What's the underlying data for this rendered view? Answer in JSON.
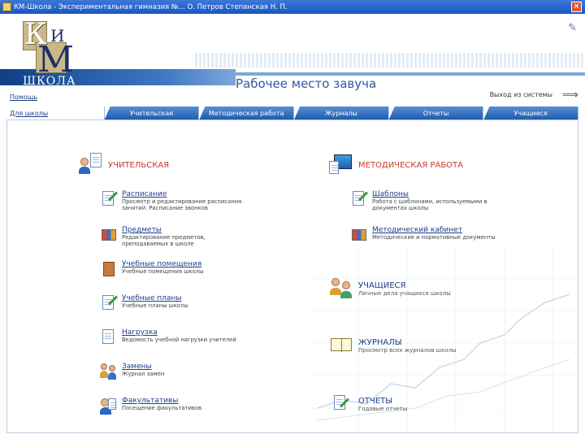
{
  "window": {
    "title": "КМ-Школа - Экспериментальная гимназия №... О. Петров Степанская Н. П."
  },
  "header": {
    "logo_text_k": "К",
    "logo_text_i": "И",
    "logo_text_m": "М",
    "logo_text_school": "ШКОЛА",
    "page_title": "Рабочее место завуча",
    "help_link": "Помощь",
    "exit_link": "Выход из системы"
  },
  "tabs": [
    {
      "label": "Для школы"
    },
    {
      "label": "Учительская"
    },
    {
      "label": "Методическая работа"
    },
    {
      "label": "Журналы"
    },
    {
      "label": "Отчеты"
    },
    {
      "label": "Учащиеся"
    }
  ],
  "left_section": {
    "title": "УЧИТЕЛЬСКАЯ",
    "items": [
      {
        "label": "Расписание",
        "desc": "Просмотр и редактирование расписания занятий. Расписание звонков"
      },
      {
        "label": "Предметы",
        "desc": "Редактирование предметов, преподаваемых в школе"
      },
      {
        "label": "Учебные помещения",
        "desc": "Учебные помещения школы"
      },
      {
        "label": "Учебные планы",
        "desc": "Учебные планы школы"
      },
      {
        "label": "Нагрузка",
        "desc": "Ведомость учебной нагрузки учителей"
      },
      {
        "label": "Замены",
        "desc": "Журнал замен"
      },
      {
        "label": "Факультативы",
        "desc": "Посещение факультативов"
      }
    ]
  },
  "right_section": {
    "title": "МЕТОДИЧЕСКАЯ РАБОТА",
    "items": [
      {
        "label": "Шаблоны",
        "desc": "Работа с шаблонами, используемыми в документах школы"
      },
      {
        "label": "Методический кабинет",
        "desc": "Методические и нормативные документы"
      }
    ]
  },
  "students_section": {
    "title": "УЧАЩИЕСЯ",
    "desc": "Личные дела учащихся школы"
  },
  "journals_section": {
    "title": "ЖУРНАЛЫ",
    "desc": "Просмотр всех журналов школы"
  },
  "reports_section": {
    "title": "ОТЧЕТЫ",
    "desc": "Годовые отчеты"
  },
  "colors": {
    "accent_blue": "#1f5bb2",
    "section_red": "#c8392b",
    "link_blue": "#1b3f8a"
  }
}
